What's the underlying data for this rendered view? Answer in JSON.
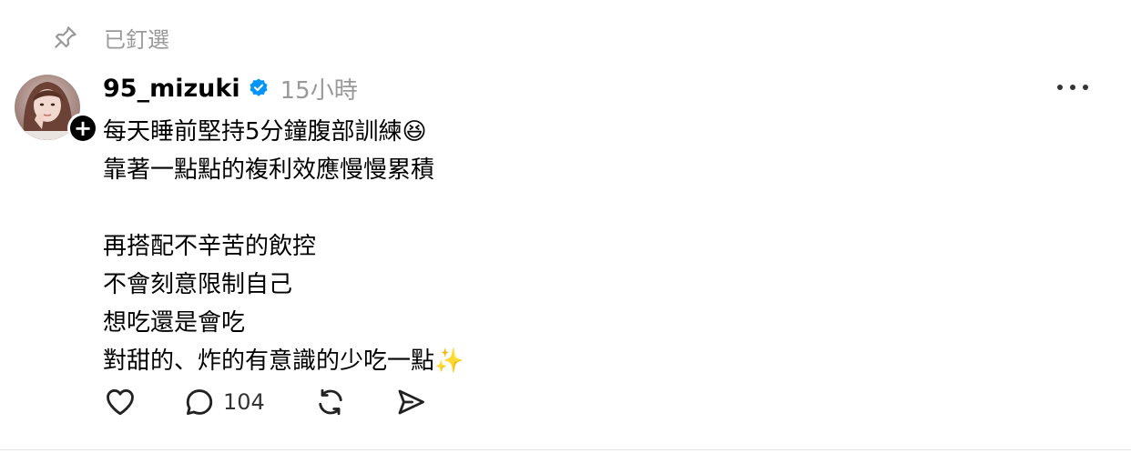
{
  "pinned": {
    "label": "已釘選",
    "icon": "pin-icon"
  },
  "post": {
    "username": "95_mizuki",
    "verified_icon": "verified-badge-icon",
    "time": "15小時",
    "avatar_icon": "avatar",
    "follow_icon": "plus-icon",
    "more_icon": "more-options-icon",
    "lines": [
      "每天睡前堅持5分鐘腹部訓練😆",
      "靠著一點點的複利效應慢慢累積",
      "再搭配不辛苦的飲控",
      "不會刻意限制自己",
      "想吃還是會吃",
      "對甜的、炸的有意識的少吃一點✨"
    ],
    "reply_count": "104"
  },
  "colors": {
    "text": "#000000",
    "secondary": "#999999",
    "verified": "#0095F6",
    "divider": "#e5e5e5"
  }
}
